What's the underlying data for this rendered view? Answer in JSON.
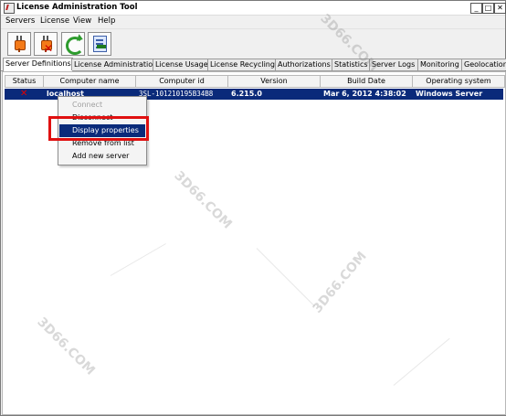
{
  "window": {
    "title": "License Administration Tool",
    "controls": [
      "_",
      "□",
      "✕"
    ]
  },
  "menubar": [
    "Servers",
    "License",
    "View",
    "Help"
  ],
  "toolbar": [
    {
      "name": "connect-button",
      "icon": "plug-icon"
    },
    {
      "name": "disconnect-button",
      "icon": "plug-disconnect-icon"
    },
    {
      "name": "refresh-button",
      "icon": "refresh-icon"
    },
    {
      "name": "display-properties-button",
      "icon": "properties-icon"
    }
  ],
  "tabs": [
    "Server Definitions",
    "License Administration",
    "License Usage",
    "License Recycling",
    "Authorizations",
    "Statistics",
    "Server Logs",
    "Monitoring",
    "Geolocation"
  ],
  "table": {
    "headers": [
      "Status",
      "Computer name",
      "Computer id",
      "Version",
      "Build Date",
      "Operating system"
    ],
    "rows": [
      {
        "status": "✕",
        "computer_name": "localhost",
        "computer_id": "3SL-101210195B34B8",
        "version": "6.215.0",
        "build_date": "Mar 6, 2012 4:38:02",
        "os": "Windows Server"
      }
    ]
  },
  "context_menu": {
    "items": [
      {
        "label": "Connect",
        "disabled": true
      },
      {
        "label": "Disconnect",
        "disabled": false
      },
      {
        "label": "Display properties",
        "selected": true
      },
      {
        "label": "Remove from list",
        "disabled": false
      },
      {
        "label": "Add new server",
        "disabled": false
      }
    ]
  },
  "watermarks": [
    "3D66.COM",
    "3D66.COM",
    "3D66.COM",
    "3D66.COM"
  ],
  "colors": {
    "selection": "#0a2a7a",
    "highlight": "#e01010",
    "status_error": "#e00000"
  }
}
